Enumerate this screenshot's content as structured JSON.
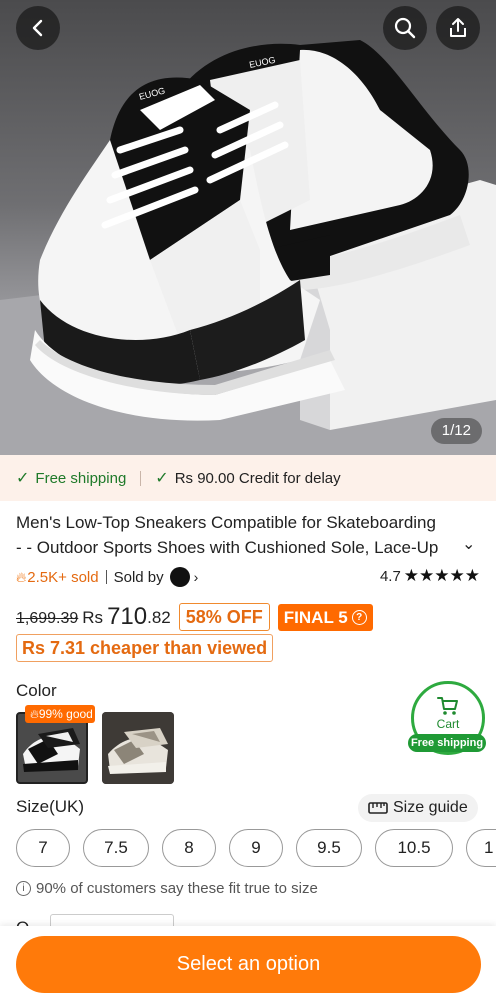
{
  "hero": {
    "counter": "1/12",
    "back_icon": "chevron-left-icon",
    "search_icon": "search-icon",
    "share_icon": "share-icon",
    "shoe_text_1": "EUOG",
    "shoe_text_2": "EUOG"
  },
  "shipping": {
    "free_shipping": "Free shipping",
    "credit": "Rs 90.00 Credit for delay",
    "colors": {
      "green": "#1f7a2a",
      "strip_bg": "#fdf1ea"
    }
  },
  "product": {
    "title_line1": "Men's Low-Top Sneakers Compatible for Skateboarding",
    "title_line2": "- - Outdoor Sports Shoes with Cushioned Sole, Lace-Up",
    "sold": "2.5K+ sold",
    "sold_by": "Sold by",
    "rating": "4.7",
    "rating_value": 4.7,
    "rating_max": 5
  },
  "price": {
    "original": "1,699.39",
    "currency": "Rs",
    "whole": "710",
    "cents": ".82",
    "discount": "58% OFF",
    "final_label": "FINAL 5",
    "cheaper": "Rs 7.31 cheaper than viewed",
    "accent": "#ff6a00"
  },
  "color": {
    "label": "Color",
    "good_badge": "99% good",
    "options": [
      "black-white",
      "grey-beige"
    ]
  },
  "cart": {
    "label": "Cart",
    "free_shipping": "Free shipping",
    "green": "#2eaa3f"
  },
  "size": {
    "label": "Size(UK)",
    "guide": "Size guide",
    "options": [
      "7",
      "7.5",
      "8",
      "9",
      "9.5",
      "10.5",
      "1"
    ],
    "fit_note": "90% of customers say these fit true to size"
  },
  "quantity": {
    "label": "Q"
  },
  "cta": {
    "label": "Select an option",
    "color": "#ff7a0a"
  }
}
